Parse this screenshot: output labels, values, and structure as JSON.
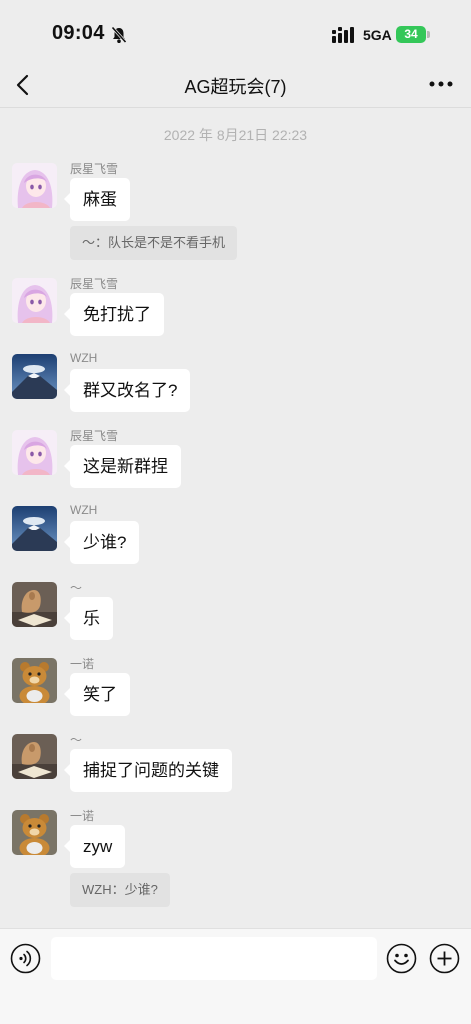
{
  "status_bar": {
    "time": "09:04",
    "network": "5GA",
    "battery": "34"
  },
  "nav": {
    "title": "AG超玩会(7)"
  },
  "timestamp": "2022 年 8月21日 22:23",
  "messages": [
    {
      "sender": "辰星飞雪",
      "text": "麻蛋",
      "avatar": "anime-girl",
      "quote": "～：队长是不是不看手机"
    },
    {
      "sender": "辰星飞雪",
      "text": "免打扰了",
      "avatar": "anime-girl"
    },
    {
      "sender": "WZH",
      "text": "群又改名了?",
      "avatar": "mountain"
    },
    {
      "sender": "辰星飞雪",
      "text": "这是新群捏",
      "avatar": "anime-girl"
    },
    {
      "sender": "WZH",
      "text": "少谁?",
      "avatar": "mountain"
    },
    {
      "sender": "～",
      "text": "乐",
      "avatar": "cat-book"
    },
    {
      "sender": "一诺",
      "text": "笑了",
      "avatar": "bear"
    },
    {
      "sender": "～",
      "text": "捕捉了问题的关键",
      "avatar": "cat-book"
    },
    {
      "sender": "一诺",
      "text": "zyw",
      "avatar": "bear",
      "quote": "WZH：少谁?"
    }
  ],
  "colors": {
    "background": "#ededed",
    "bubble": "#ffffff",
    "quote": "#e2e2e2",
    "battery": "#34c759"
  }
}
